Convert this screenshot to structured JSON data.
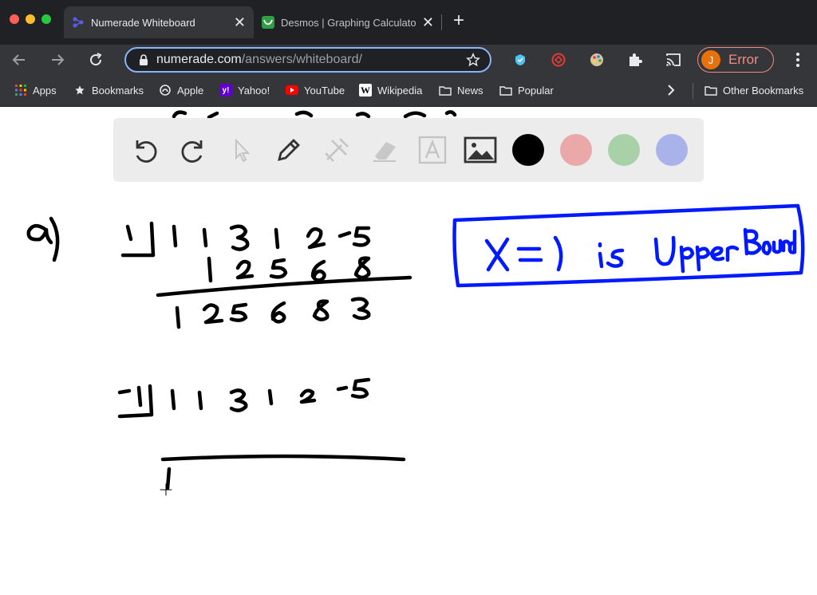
{
  "browser": {
    "tabs": [
      {
        "title": "Numerade Whiteboard",
        "active": true,
        "icon": "numerade-icon"
      },
      {
        "title": "Desmos | Graphing Calculato",
        "active": false,
        "icon": "desmos-icon"
      }
    ],
    "new_tab_icon": "plus-icon",
    "address": {
      "domain": "numerade.com",
      "path": "/answers/whiteboard/"
    },
    "profile": {
      "initial": "J",
      "status": "Error"
    },
    "extensions": [
      "shield-extension-icon",
      "red-extension-icon",
      "palette-extension-icon",
      "puzzle-extensions-icon",
      "cast-icon"
    ],
    "bookmarks": [
      {
        "label": "Apps",
        "icon": "apps-grid-icon"
      },
      {
        "label": "Bookmarks",
        "icon": "star-icon"
      },
      {
        "label": "Apple",
        "icon": "apple-icon"
      },
      {
        "label": "Yahoo!",
        "icon": "yahoo-icon"
      },
      {
        "label": "YouTube",
        "icon": "youtube-icon"
      },
      {
        "label": "Wikipedia",
        "icon": "wikipedia-icon"
      },
      {
        "label": "News",
        "icon": "folder-icon"
      },
      {
        "label": "Popular",
        "icon": "folder-icon"
      }
    ],
    "other_bookmarks": "Other Bookmarks"
  },
  "whiteboard": {
    "tools": [
      "undo-icon",
      "redo-icon",
      "pointer-icon",
      "pen-icon",
      "tools-icon",
      "eraser-icon",
      "text-icon",
      "image-icon"
    ],
    "colors": [
      "#000000",
      "#eaa9a8",
      "#a9d1a8",
      "#a9b3ea"
    ],
    "ink_color": "#000000",
    "box_color": "#0019ff",
    "part_label": "a)",
    "answer_note": "X=1 is Upper Bound",
    "division_1": {
      "divisor": "1",
      "coefficients": [
        "1",
        "1",
        "3",
        "1",
        "2",
        "-5"
      ],
      "products": [
        "1",
        "2",
        "5",
        "6",
        "8"
      ],
      "result": [
        "1",
        "2",
        "5",
        "6",
        "8",
        "3"
      ]
    },
    "division_2": {
      "divisor": "-1",
      "coefficients": [
        "1",
        "1",
        "3",
        "1",
        "2",
        "-5"
      ],
      "result": [
        "1"
      ]
    }
  }
}
